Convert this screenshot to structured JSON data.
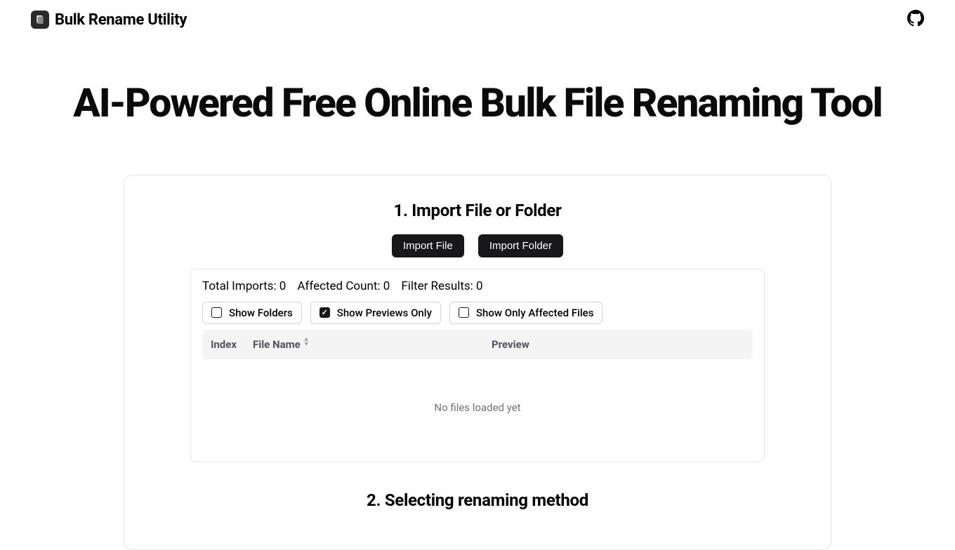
{
  "header": {
    "title": "Bulk Rename Utility"
  },
  "hero": {
    "title": "AI-Powered Free Online Bulk File Renaming Tool"
  },
  "section1": {
    "title": "1. Import File or Folder",
    "buttons": {
      "import_file": "Import File",
      "import_folder": "Import Folder"
    },
    "stats": {
      "total_imports": "Total Imports: 0",
      "affected_count": "Affected Count: 0",
      "filter_results": "Filter Results: 0"
    },
    "toggles": {
      "show_folders": "Show Folders",
      "show_previews_only": "Show Previews Only",
      "show_only_affected": "Show Only Affected Files"
    },
    "table": {
      "headers": {
        "index": "Index",
        "filename": "File Name",
        "preview": "Preview"
      },
      "empty": "No files loaded yet"
    }
  },
  "section2": {
    "title": "2. Selecting renaming method"
  }
}
